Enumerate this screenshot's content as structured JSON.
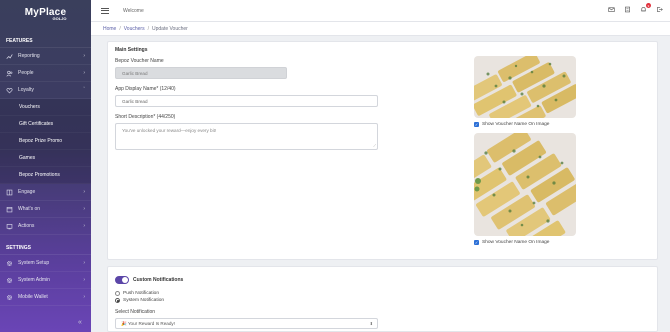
{
  "app": {
    "logo_main": "MyPlace",
    "logo_sub": "GOLJO"
  },
  "sidebar": {
    "features_heading": "FEATURES",
    "settings_heading": "SETTINGS",
    "items": [
      {
        "label": "Reporting",
        "icon": "chart-line-icon"
      },
      {
        "label": "People",
        "icon": "people-icon"
      },
      {
        "label": "Loyalty",
        "icon": "heart-icon"
      }
    ],
    "loyalty_sub": [
      "Vouchers",
      "Gift Certificates",
      "Bepoz Prize Promo",
      "Games",
      "Bepoz Promotions"
    ],
    "items2": [
      {
        "label": "Engage",
        "icon": "engage-icon"
      },
      {
        "label": "What's on",
        "icon": "calendar-icon"
      },
      {
        "label": "Actions",
        "icon": "actions-icon"
      }
    ],
    "settings_items": [
      {
        "label": "System Setup",
        "icon": "gear-icon"
      },
      {
        "label": "System Admin",
        "icon": "gear-icon"
      },
      {
        "label": "Mobile Wallet",
        "icon": "gear-icon"
      }
    ],
    "collapse": "«"
  },
  "topbar": {
    "welcome": "Welcome",
    "notification_count": "9"
  },
  "breadcrumb": {
    "home": "Home",
    "vouchers": "Vouchers",
    "current": "Update Voucher",
    "sep": "/"
  },
  "main_settings": {
    "title": "Main Settings",
    "bepoz_label": "Bepoz Voucher Name",
    "bepoz_value": "Garlic Bread",
    "display_label": "App Display Name* (12/40)",
    "display_value": "Garlic Bread",
    "desc_label": "Short Description* (44/250)",
    "desc_value": "You've unlocked your reward—enjoy every bit!",
    "show_name_1": "Show Voucher Name On Image",
    "show_name_2": "Show Voucher Name On Image"
  },
  "notifications": {
    "title": "Custom Notifications",
    "push_label": "Push Notification",
    "system_label": "System Notification",
    "select_label": "Select Notification",
    "select_value": "🎉 Your Reward Is Ready!",
    "selected_type": "System Notification"
  },
  "colors": {
    "accent": "#5b46a8",
    "checkbox": "#2c6fd6",
    "badge": "#e0303c"
  }
}
